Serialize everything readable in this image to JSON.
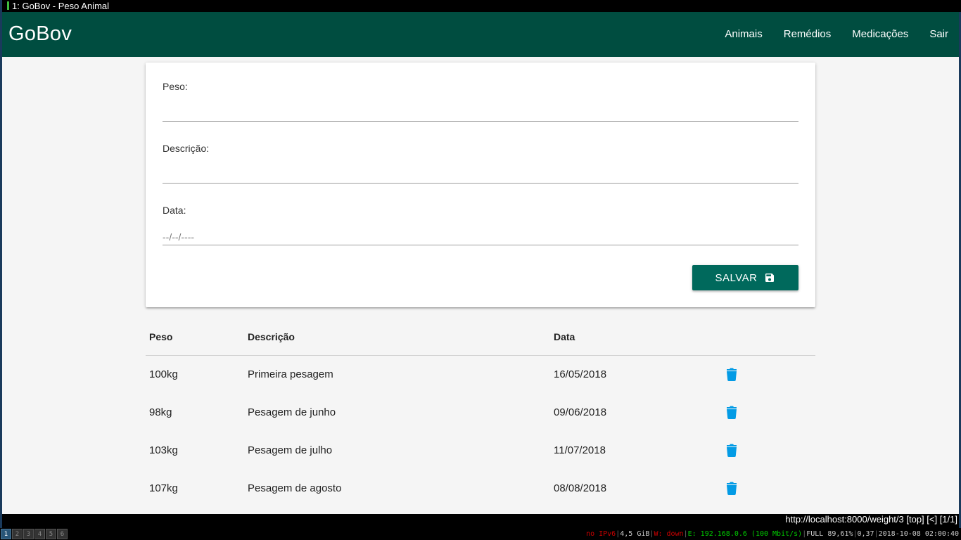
{
  "window": {
    "title": "1: GoBov - Peso Animal"
  },
  "navbar": {
    "brand": "GoBov",
    "links": [
      "Animais",
      "Remédios",
      "Medicações",
      "Sair"
    ],
    "color": "#004d40"
  },
  "form": {
    "peso_label": "Peso:",
    "peso_value": "",
    "descricao_label": "Descrição:",
    "descricao_value": "",
    "data_label": "Data:",
    "data_placeholder": "--/--/----",
    "save_label": "SALVAR",
    "save_icon": "floppy-disk-icon",
    "save_color": "#00695c"
  },
  "table": {
    "headers": [
      "Peso",
      "Descrição",
      "Data"
    ],
    "rows": [
      {
        "peso": "100kg",
        "descricao": "Primeira pesagem",
        "data": "16/05/2018"
      },
      {
        "peso": "98kg",
        "descricao": "Pesagem de junho",
        "data": "09/06/2018"
      },
      {
        "peso": "103kg",
        "descricao": "Pesagem de julho",
        "data": "11/07/2018"
      },
      {
        "peso": "107kg",
        "descricao": "Pesagem de agosto",
        "data": "08/08/2018"
      }
    ],
    "delete_icon": "trash-icon",
    "delete_color": "#039be5"
  },
  "browser": {
    "status_line": "http://localhost:8000/weight/3 [top] [<] [1/1]"
  },
  "sysbar": {
    "workspaces": [
      "1",
      "2",
      "3",
      "4",
      "5",
      "6"
    ],
    "active_workspace": "1",
    "ipv6": "no IPv6",
    "disk": "4,5 GiB",
    "wireless": "W: down",
    "ethernet": "E: 192.168.0.6 (100 Mbit/s)",
    "battery": "FULL 89,61%",
    "load": "0,37",
    "datetime": "2018-10-08 02:00:40"
  }
}
